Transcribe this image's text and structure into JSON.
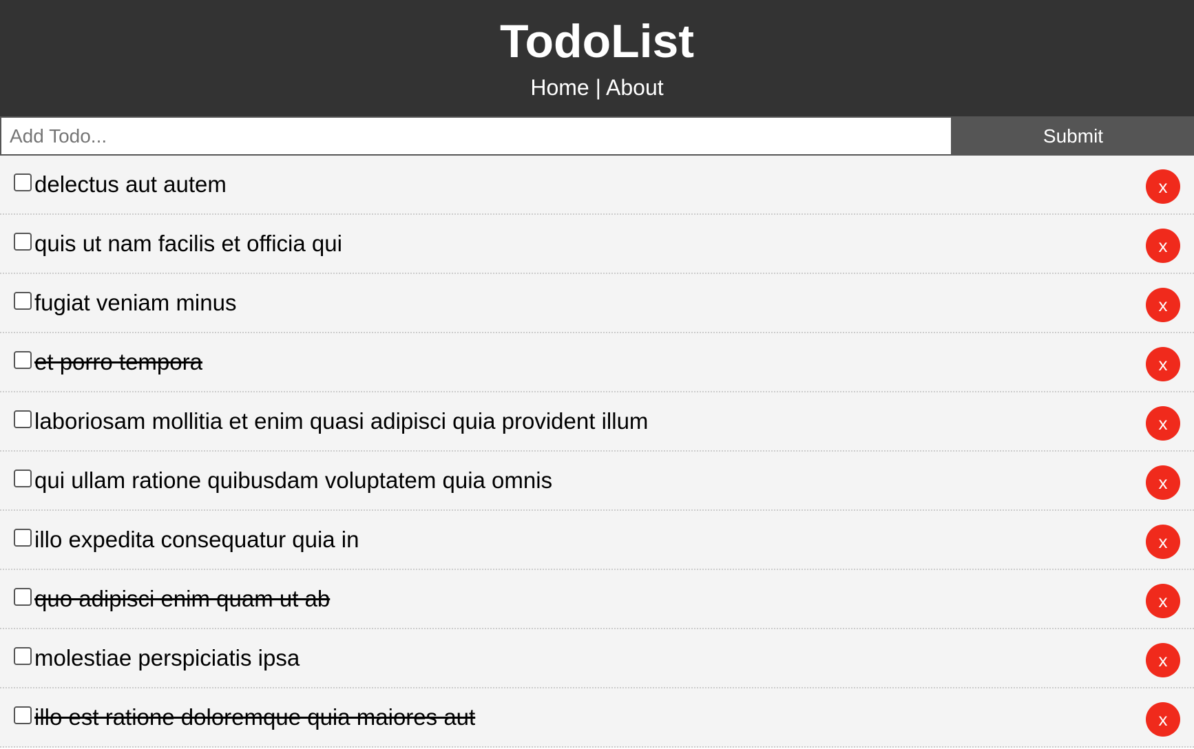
{
  "header": {
    "title": "TodoList",
    "nav": {
      "home": "Home",
      "separator": "|",
      "about": "About"
    }
  },
  "add_form": {
    "placeholder": "Add Todo...",
    "value": "",
    "submit_label": "Submit"
  },
  "todos": [
    {
      "title": "delectus aut autem",
      "completed": false,
      "delete_label": "x"
    },
    {
      "title": "quis ut nam facilis et officia qui",
      "completed": false,
      "delete_label": "x"
    },
    {
      "title": "fugiat veniam minus",
      "completed": false,
      "delete_label": "x"
    },
    {
      "title": "et porro tempora",
      "completed": true,
      "delete_label": "x"
    },
    {
      "title": "laboriosam mollitia et enim quasi adipisci quia provident illum",
      "completed": false,
      "delete_label": "x"
    },
    {
      "title": "qui ullam ratione quibusdam voluptatem quia omnis",
      "completed": false,
      "delete_label": "x"
    },
    {
      "title": "illo expedita consequatur quia in",
      "completed": false,
      "delete_label": "x"
    },
    {
      "title": "quo adipisci enim quam ut ab",
      "completed": true,
      "delete_label": "x"
    },
    {
      "title": "molestiae perspiciatis ipsa",
      "completed": false,
      "delete_label": "x"
    },
    {
      "title": "illo est ratione doloremque quia maiores aut",
      "completed": true,
      "delete_label": "x"
    }
  ],
  "colors": {
    "header_bg": "#333333",
    "submit_bg": "#555555",
    "item_bg": "#f4f4f4",
    "delete_bg": "#f02a1c"
  }
}
